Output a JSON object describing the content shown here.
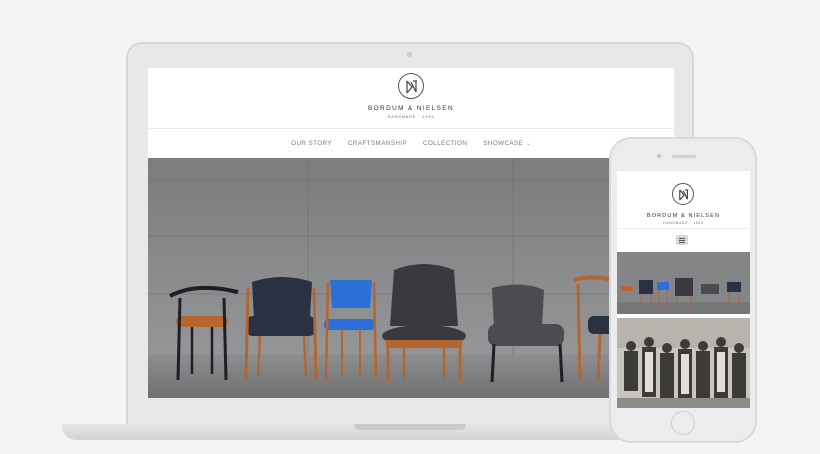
{
  "brand": {
    "name": "BORDUM & NIELSEN",
    "tagline": "HANDMADE · 1945"
  },
  "nav": {
    "items": [
      "OUR STORY",
      "CRAFTSMANSHIP",
      "COLLECTION",
      "SHOWCASE"
    ],
    "dropdown_indicator": "chevron-down-icon"
  },
  "mobile": {
    "brand_name": "BORDUM & NIELSEN",
    "brand_tagline": "HANDMADE · 1945",
    "menu_icon": "hamburger-icon"
  },
  "colors": {
    "chair_blue": "#2c6fd6",
    "chair_navy": "#2a3142",
    "wood": "#b5652f",
    "concrete": "#8a8b8d"
  }
}
